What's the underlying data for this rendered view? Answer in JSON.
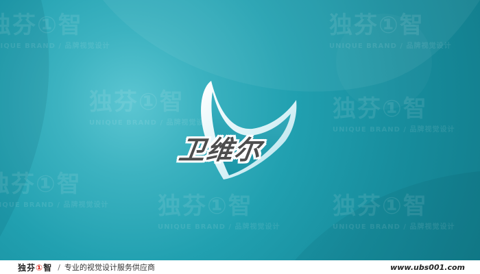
{
  "logo": {
    "wordmark": "卫维尔"
  },
  "watermark": {
    "brand_text": "独芬①智",
    "sub_text": "UNIQUE BRAND / 品牌视觉设计"
  },
  "footer": {
    "brand_prefix": "独芬",
    "brand_accent": "①",
    "brand_suffix": "智",
    "separator": "/",
    "tagline": "专业的视觉设计服务供应商",
    "url": "www.ubs001.com"
  },
  "colors": {
    "background": "#21a0b0",
    "background_light": "#5cc6d2",
    "wordmark": "#4d4d4d",
    "footer_accent": "#d9261c"
  }
}
